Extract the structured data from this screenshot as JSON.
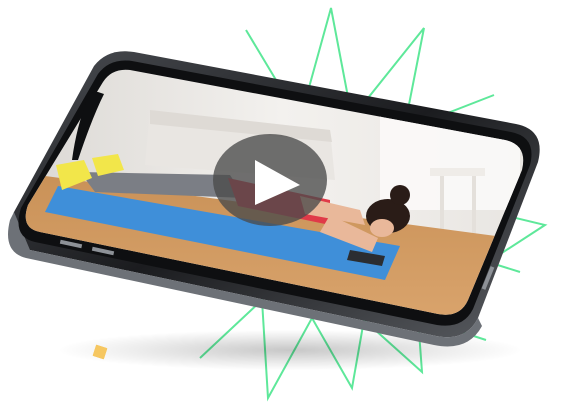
{
  "colors": {
    "burst": "#5ee89a",
    "accent_square": "#f6c761",
    "phone_frame": "#1b1c1f",
    "phone_edge": "#3a3d42",
    "mat": "#3f8fd9",
    "floor": "#d8a36b",
    "wall": "#f1efec",
    "sofa": "#e9e6e2",
    "legging": "#7b7e85",
    "top": "#e03a48",
    "shoe": "#f2e64a",
    "skin": "#e9b89a",
    "hair": "#2a1c17",
    "play_overlay": "#4a4a4a"
  },
  "icons": {
    "play": "play-icon",
    "accent": "accent-square-icon"
  }
}
